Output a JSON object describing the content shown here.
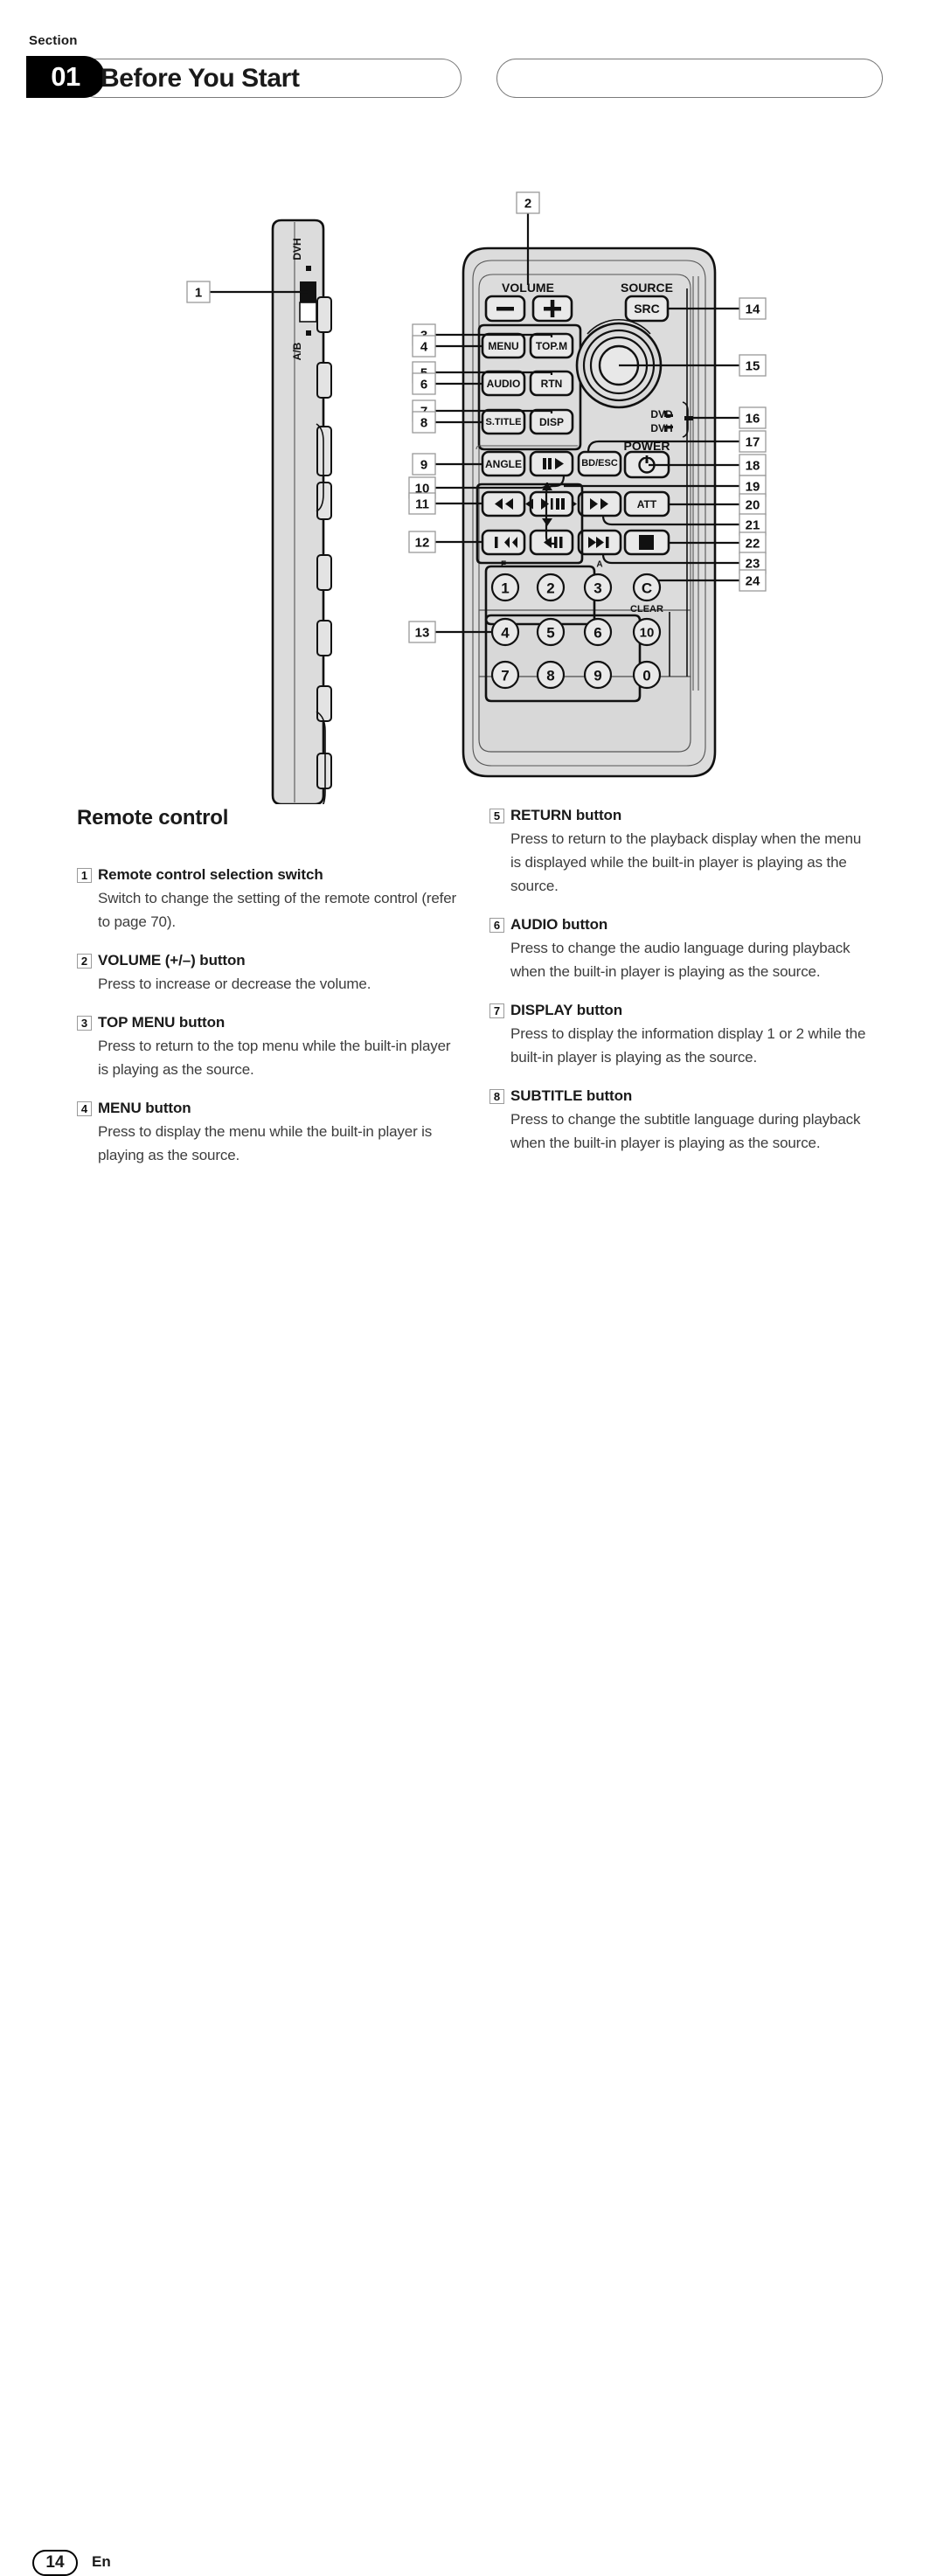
{
  "header": {
    "section_label": "Section",
    "section_number": "01",
    "title": "Before You Start"
  },
  "figure": {
    "device_switch": {
      "label_top": "DVH",
      "label_bottom": "A/B"
    },
    "remote": {
      "volume_label": "VOLUME",
      "volume_minus": "–",
      "volume_plus": "+",
      "source_label": "SOURCE",
      "src_button": "SRC",
      "menu_button": "MENU",
      "topmenu_button": "TOP.M",
      "audio_button": "AUDIO",
      "rtn_button": "RTN",
      "stitle_button": "S.TITLE",
      "disp_button": "DISP",
      "angle_button": "ANGLE",
      "slow_button": "II▶",
      "rev_button": "◀◀",
      "playpause_button": "▶/II",
      "fwd_button": "▶▶",
      "prev_button": "I◀◀",
      "stepback_button": "◀II",
      "next_button": "▶▶I",
      "bdesc_button": "BD/ESC",
      "power_label": "POWER",
      "power_button": "⏻",
      "att_button": "ATT",
      "stop_button": "■",
      "dvd_label": "DVD",
      "dvh_label": "DVH",
      "clear_label": "CLEAR",
      "clear_button": "C",
      "f_label": "F",
      "a_label": "A",
      "keypad": [
        [
          "1",
          "2",
          "3"
        ],
        [
          "4",
          "5",
          "6"
        ],
        [
          "7",
          "8",
          "9"
        ]
      ],
      "keypad_right": [
        "10",
        "0"
      ],
      "up_arrow": "▲",
      "down_arrow": "▼",
      "left_arrow": "◀",
      "right_arrow": "▶"
    },
    "callouts_left": [
      "1",
      "2",
      "3",
      "4",
      "5",
      "6",
      "7",
      "8",
      "9",
      "10",
      "11",
      "12",
      "13"
    ],
    "callouts_right": [
      "14",
      "15",
      "16",
      "17",
      "18",
      "19",
      "20",
      "21",
      "22",
      "23",
      "24"
    ]
  },
  "body": {
    "remote_heading": "Remote control",
    "left_entries": [
      {
        "num": "1",
        "title": "Remote control selection switch",
        "text": "Switch to change the setting of the remote control (refer to page 70)."
      },
      {
        "num": "2",
        "title": "VOLUME (+/–) button",
        "text": "Press to increase or decrease the volume."
      },
      {
        "num": "3",
        "title": "TOP MENU button",
        "text": "Press to return to the top menu while the built-in player is playing as the source."
      },
      {
        "num": "4",
        "title": "MENU button",
        "text": "Press to display the menu while the built-in player is playing as the source."
      }
    ],
    "right_entries": [
      {
        "num": "5",
        "title": "RETURN button",
        "text": "Press to return to the playback display when the menu is displayed while the built-in player is playing as the source."
      },
      {
        "num": "6",
        "title": "AUDIO button",
        "text": "Press to change the audio language during playback when the built-in player is playing as the source."
      },
      {
        "num": "7",
        "title": "DISPLAY button",
        "text": "Press to display the information display 1 or 2 while the built-in player is playing as the source."
      },
      {
        "num": "8",
        "title": "SUBTITLE button",
        "text": "Press to change the subtitle language during playback when the built-in player is playing as the source."
      }
    ]
  },
  "footer": {
    "page_number": "14",
    "language": "En"
  }
}
